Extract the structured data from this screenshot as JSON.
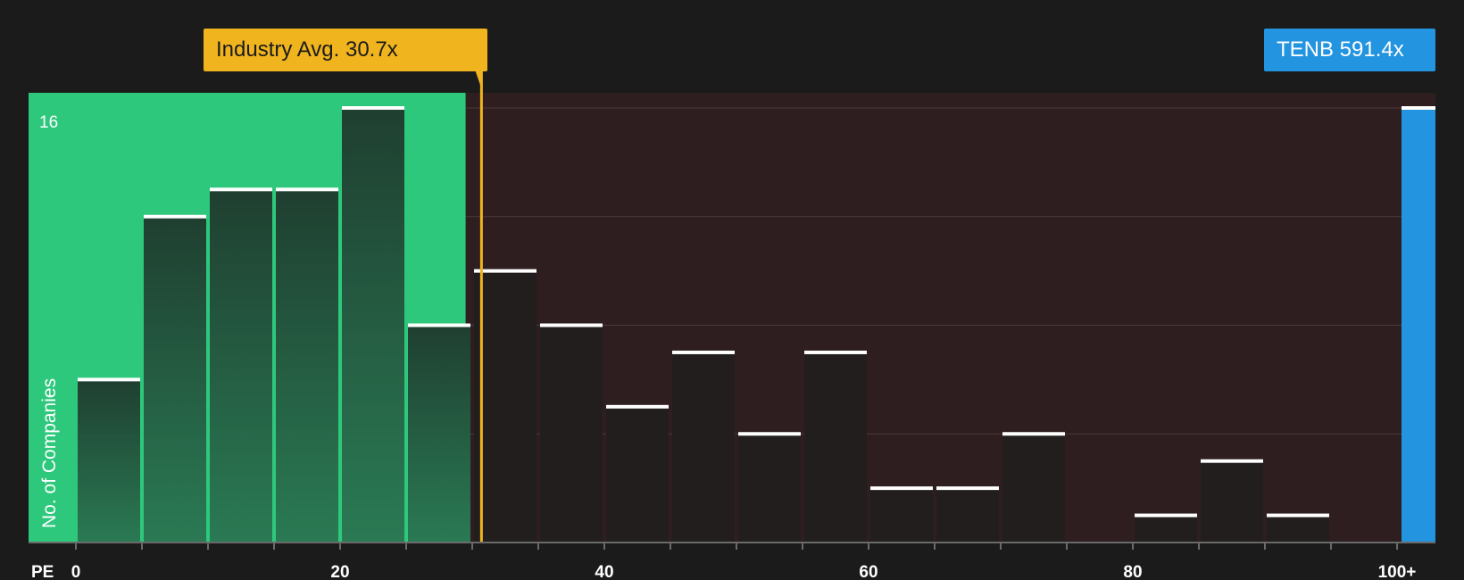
{
  "chart_data": {
    "type": "bar",
    "title": "",
    "xlabel": "PE",
    "ylabel": "No. of Companies",
    "bin_width": 5,
    "x_ticks": [
      {
        "value": 0,
        "label": "0"
      },
      {
        "value": 20,
        "label": "20"
      },
      {
        "value": 40,
        "label": "40"
      },
      {
        "value": 60,
        "label": "60"
      },
      {
        "value": 80,
        "label": "80"
      },
      {
        "value": 100,
        "label": "100+"
      }
    ],
    "y_tick_label": "16",
    "ylim": [
      0,
      16
    ],
    "bins": [
      {
        "start": 0,
        "value": 6
      },
      {
        "start": 5,
        "value": 12
      },
      {
        "start": 10,
        "value": 13
      },
      {
        "start": 15,
        "value": 13
      },
      {
        "start": 20,
        "value": 16
      },
      {
        "start": 25,
        "value": 8
      },
      {
        "start": 30,
        "value": 10
      },
      {
        "start": 35,
        "value": 8
      },
      {
        "start": 40,
        "value": 5
      },
      {
        "start": 45,
        "value": 7
      },
      {
        "start": 50,
        "value": 4
      },
      {
        "start": 55,
        "value": 7
      },
      {
        "start": 60,
        "value": 2
      },
      {
        "start": 65,
        "value": 2
      },
      {
        "start": 70,
        "value": 4
      },
      {
        "start": 75,
        "value": 0
      },
      {
        "start": 80,
        "value": 1
      },
      {
        "start": 85,
        "value": 3
      },
      {
        "start": 90,
        "value": 1
      },
      {
        "start": 95,
        "value": 0
      }
    ],
    "overflow_bin": {
      "label": "100+",
      "value": 16
    },
    "fair_range_end": 29.5,
    "industry_avg": {
      "value": 30.7,
      "label": "Industry Avg. 30.7x"
    },
    "company": {
      "ticker": "TENB",
      "value": 591.4,
      "label": "TENB 591.4x"
    },
    "colors": {
      "background": "#1b1b1b",
      "fair_zone": "#2ec87c",
      "expensive_zone": "#2f1e1f",
      "bar_in_fair": "#1f4a35",
      "bar_expensive": "#231e1e",
      "industry": "#f0b41e",
      "company": "#2394e0",
      "bar_cap": "#ffffff"
    }
  }
}
